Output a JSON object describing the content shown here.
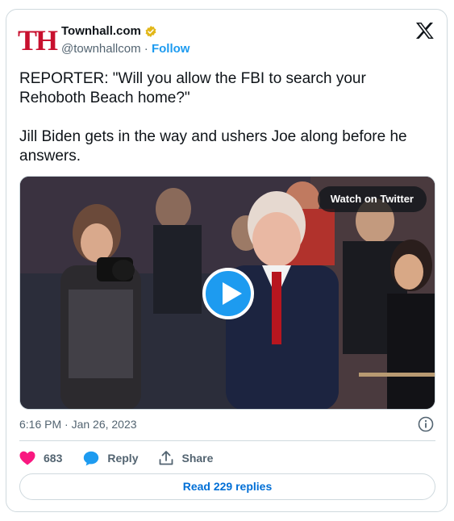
{
  "author": {
    "logo_text": "TH",
    "name": "Townhall.com",
    "handle": "@townhallcom",
    "separator": "·",
    "follow_label": "Follow"
  },
  "tweet": {
    "text": "REPORTER: \"Will you allow the FBI to search your Rehoboth Beach home?\"\n\nJill Biden gets in the way and ushers Joe along before he answers."
  },
  "media": {
    "watch_label": "Watch on Twitter"
  },
  "meta": {
    "timestamp": "6:16 PM · Jan 26, 2023"
  },
  "actions": {
    "likes": "683",
    "reply_label": "Reply",
    "share_label": "Share"
  },
  "footer": {
    "read_replies_label": "Read 229 replies"
  },
  "colors": {
    "accent": "#1d9bf0",
    "link": "#006fd6",
    "like": "#f91880",
    "brand": "#c8102e",
    "verified": "#e2b719"
  },
  "icons": [
    "verified-badge-icon",
    "x-logo-icon",
    "play-icon",
    "info-icon",
    "heart-icon",
    "reply-bubble-icon",
    "share-icon"
  ]
}
